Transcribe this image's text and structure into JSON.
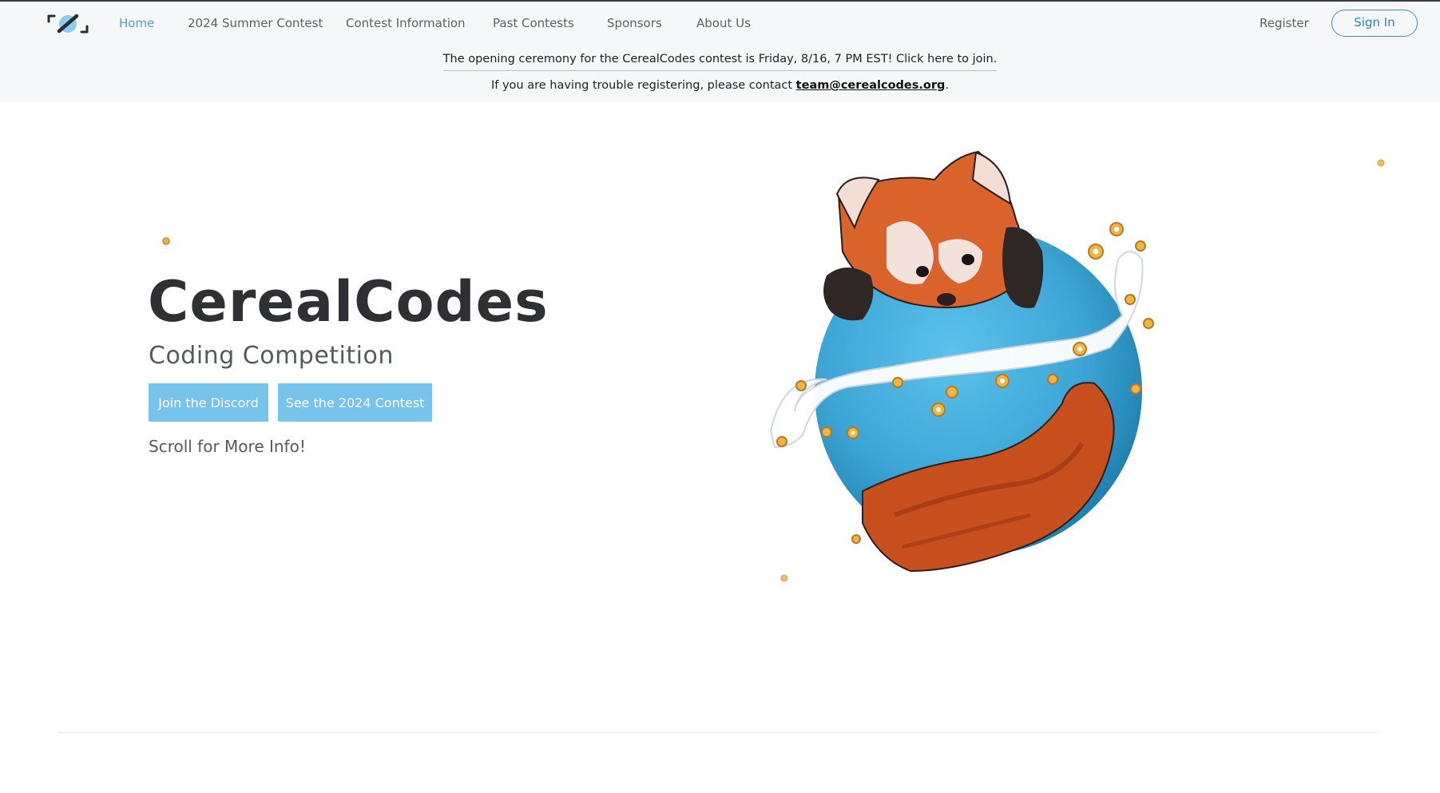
{
  "nav": {
    "logo_icon": "cerealcodes-logo-icon",
    "items": [
      {
        "label": "Home",
        "active": true
      },
      {
        "label": "2024 Summer Contest",
        "active": false
      },
      {
        "label": "Contest Information",
        "active": false
      },
      {
        "label": "Past Contests",
        "active": false
      },
      {
        "label": "Sponsors",
        "active": false
      },
      {
        "label": "About Us",
        "active": false
      }
    ],
    "register_label": "Register",
    "signin_label": "Sign In"
  },
  "announcement": {
    "line1": "The opening ceremony for the CerealCodes contest is Friday, 8/16, 7 PM EST! Click here to join.",
    "line2_prefix": "If you are having trouble registering, please contact ",
    "line2_email": "team@cerealcodes.org",
    "line2_suffix": "."
  },
  "hero": {
    "title": "CerealCodes",
    "subtitle": "Coding Competition",
    "discord_button": "Join the Discord",
    "contest_button": "See the 2024 Contest",
    "scroll_hint": "Scroll for More Info!",
    "mascot_icon": "red-panda-globe-illustration"
  },
  "colors": {
    "accent": "#4f9fd8",
    "button": "#76c4ec",
    "signin_border": "#3f8fd0",
    "nav_bg": "#f6f7f9"
  }
}
